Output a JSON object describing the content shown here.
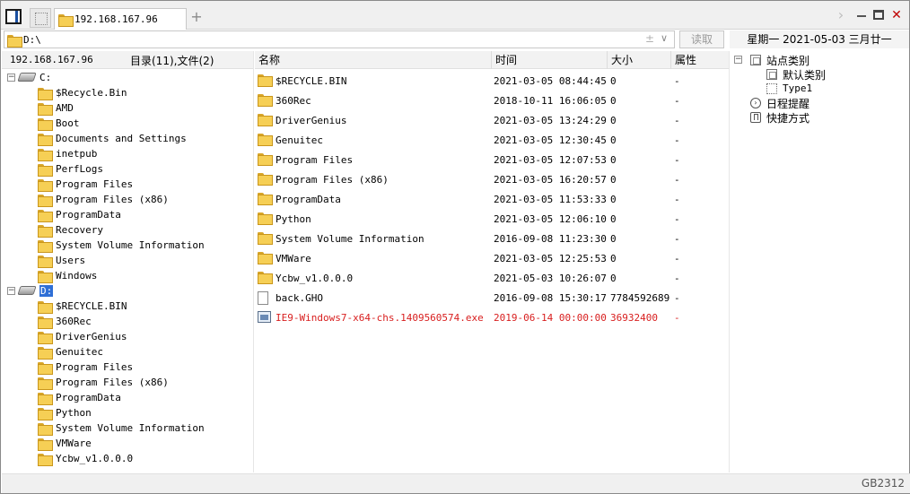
{
  "tabs": {
    "active_label": "192.168.167.96",
    "add_label": "+"
  },
  "window_controls": {
    "chevron": "›",
    "close": "✕"
  },
  "address": {
    "value": "D:\\",
    "up_glyph": "±",
    "dropdown_glyph": "∨"
  },
  "read_button": "读取",
  "date_bar": "星期一  2021-05-03  三月廿一",
  "left_header": {
    "host": "192.168.167.96",
    "counts": "目录(11),文件(2)"
  },
  "tree": {
    "drive_c": {
      "label": "C:",
      "expander": "−"
    },
    "drive_c_children": [
      "$Recycle.Bin",
      "AMD",
      "Boot",
      "Documents and Settings",
      "inetpub",
      "PerfLogs",
      "Program Files",
      "Program Files (x86)",
      "ProgramData",
      "Recovery",
      "System Volume Information",
      "Users",
      "Windows"
    ],
    "drive_d": {
      "label": "D:",
      "expander": "−"
    },
    "drive_d_children": [
      "$RECYCLE.BIN",
      "360Rec",
      "DriverGenius",
      "Genuitec",
      "Program Files",
      "Program Files (x86)",
      "ProgramData",
      "Python",
      "System Volume Information",
      "VMWare",
      "Ycbw_v1.0.0.0"
    ]
  },
  "file_list": {
    "headers": {
      "name": "名称",
      "time": "时间",
      "size": "大小",
      "attr": "属性"
    },
    "rows": [
      {
        "name": "$RECYCLE.BIN",
        "time": "2021-03-05 08:44:45",
        "size": "0",
        "attr": "-",
        "icon": "folder-icon"
      },
      {
        "name": "360Rec",
        "time": "2018-10-11 16:06:05",
        "size": "0",
        "attr": "-",
        "icon": "folder-icon"
      },
      {
        "name": "DriverGenius",
        "time": "2021-03-05 13:24:29",
        "size": "0",
        "attr": "-",
        "icon": "folder-icon"
      },
      {
        "name": "Genuitec",
        "time": "2021-03-05 12:30:45",
        "size": "0",
        "attr": "-",
        "icon": "folder-icon"
      },
      {
        "name": "Program Files",
        "time": "2021-03-05 12:07:53",
        "size": "0",
        "attr": "-",
        "icon": "folder-icon"
      },
      {
        "name": "Program Files (x86)",
        "time": "2021-03-05 16:20:57",
        "size": "0",
        "attr": "-",
        "icon": "folder-icon"
      },
      {
        "name": "ProgramData",
        "time": "2021-03-05 11:53:33",
        "size": "0",
        "attr": "-",
        "icon": "folder-icon"
      },
      {
        "name": "Python",
        "time": "2021-03-05 12:06:10",
        "size": "0",
        "attr": "-",
        "icon": "folder-icon"
      },
      {
        "name": "System Volume Information",
        "time": "2016-09-08 11:23:30",
        "size": "0",
        "attr": "-",
        "icon": "folder-icon"
      },
      {
        "name": "VMWare",
        "time": "2021-03-05 12:25:53",
        "size": "0",
        "attr": "-",
        "icon": "folder-icon"
      },
      {
        "name": "Ycbw_v1.0.0.0",
        "time": "2021-05-03 10:26:07",
        "size": "0",
        "attr": "-",
        "icon": "folder-icon"
      },
      {
        "name": "back.GHO",
        "time": "2016-09-08 15:30:17",
        "size": "7784592689",
        "attr": "-",
        "icon": "document-icon"
      },
      {
        "name": "IE9-Windows7-x64-chs.1409560574.exe",
        "time": "2019-06-14 00:00:00",
        "size": "36932400",
        "attr": "-",
        "icon": "executable-icon",
        "highlight_color": "#d81e1e"
      }
    ]
  },
  "right_tree": {
    "root": {
      "label": "站点类别",
      "expander": "−"
    },
    "children": [
      "默认类别",
      "Type1"
    ],
    "reminder": {
      "label": "日程提醒",
      "icon_glyph": "›"
    },
    "shortcuts": "快捷方式"
  },
  "status": {
    "encoding": "GB2312"
  },
  "colors": {
    "selection": "#2f6fd6",
    "folder": "#f6cf55",
    "highlight": "#d81e1e",
    "close": "#c00000"
  }
}
